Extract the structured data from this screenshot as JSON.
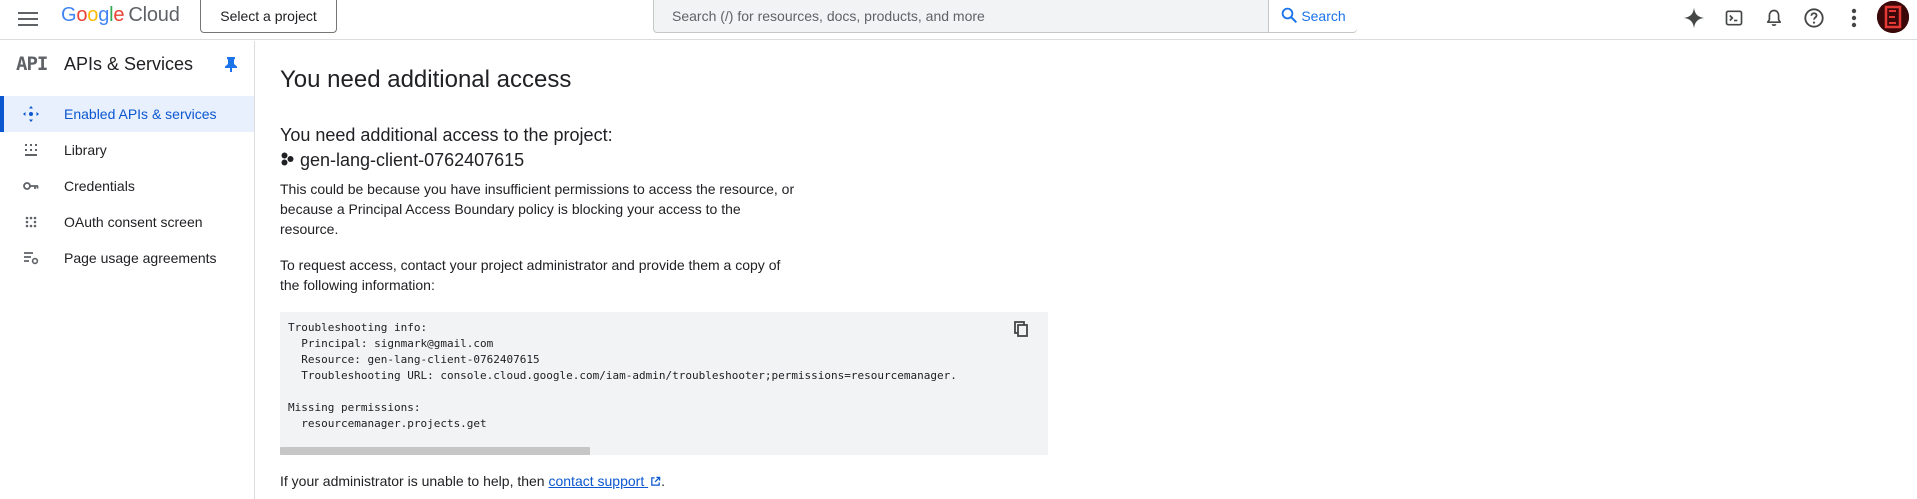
{
  "header": {
    "logo_letters": [
      "G",
      "o",
      "o",
      "g",
      "l",
      "e"
    ],
    "logo_suffix": "Cloud",
    "select_project_label": "Select a project",
    "search_placeholder": "Search (/) for resources, docs, products, and more",
    "search_button_label": "Search",
    "icons": [
      "menu-icon",
      "gemini-sparkle-icon",
      "cloud-shell-icon",
      "notifications-icon",
      "help-icon",
      "more-vert-icon",
      "avatar"
    ],
    "colors": {
      "google_blue": "#4285F4",
      "google_red": "#EA4335",
      "google_yellow": "#FBBC05",
      "google_green": "#34A853",
      "accent": "#1a73e8"
    }
  },
  "sidebar": {
    "logo_text": "API",
    "title": "APIs & Services",
    "items": [
      {
        "label": "Enabled APIs & services",
        "icon": "enabled-apis-icon",
        "active": true
      },
      {
        "label": "Library",
        "icon": "library-icon",
        "active": false
      },
      {
        "label": "Credentials",
        "icon": "key-icon",
        "active": false
      },
      {
        "label": "OAuth consent screen",
        "icon": "oauth-icon",
        "active": false
      },
      {
        "label": "Page usage agreements",
        "icon": "settings-list-icon",
        "active": false
      }
    ]
  },
  "main": {
    "title": "You need additional access",
    "subtitle": "You need additional access to the project:",
    "project_name": "gen-lang-client-0762407615",
    "para1": "This could be because you have insufficient permissions to access the resource, or because a Principal Access Boundary policy is blocking your access to the resource.",
    "para2": "To request access, contact your project administrator and provide them a copy of the following information:",
    "troubleshooting_text": "Troubleshooting info:\n  Principal: signmark@gmail.com\n  Resource: gen-lang-client-0762407615\n  Troubleshooting URL: console.cloud.google.com/iam-admin/troubleshooter;permissions=resourcemanager.\n\nMissing permissions:\n  resourcemanager.projects.get",
    "footer_prefix": "If your administrator is unable to help, then ",
    "footer_link": "contact support",
    "footer_suffix": "."
  }
}
